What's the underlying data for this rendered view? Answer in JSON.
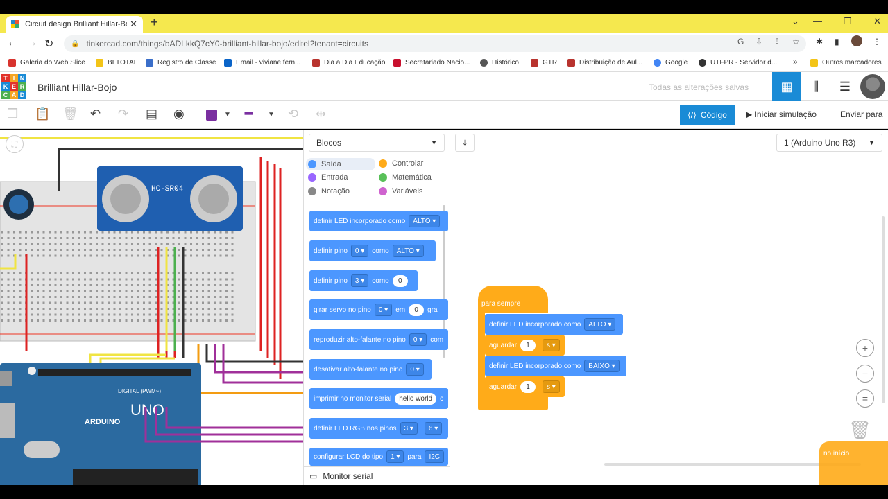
{
  "browser": {
    "tab_title": "Circuit design Brilliant Hillar-Bojo",
    "url": "tinkercad.com/things/bADLkkQ7cY0-brilliant-hillar-bojo/editel?tenant=circuits",
    "bookmarks": [
      "Galeria do Web Slice",
      "BI TOTAL",
      "Registro de Classe",
      "Email - viviane fern...",
      "Dia a Dia Educação",
      "Secretariado Nacio...",
      "Histórico",
      "GTR",
      "Distribuição de Aul...",
      "Google",
      "UTFPR - Servidor d..."
    ],
    "more_bookmarks": "»",
    "other_bookmarks": "Outros marcadores"
  },
  "app": {
    "logo_letters": [
      "T",
      "I",
      "N",
      "K",
      "E",
      "R",
      "C",
      "A",
      "D"
    ],
    "project_title": "Brilliant Hillar-Bojo",
    "save_status": "Todas as alterações salvas"
  },
  "toolbar": {
    "code_label": "Código",
    "simulate_label": "Iniciar simulação",
    "send_label": "Enviar para"
  },
  "code_panel": {
    "mode_select": "Blocos",
    "device_select": "1 (Arduino Uno R3)",
    "categories": [
      {
        "label": "Saída",
        "color": "#4c97ff"
      },
      {
        "label": "Controlar",
        "color": "#ffab19"
      },
      {
        "label": "Entrada",
        "color": "#9966ff"
      },
      {
        "label": "Matemática",
        "color": "#59c059"
      },
      {
        "label": "Notação",
        "color": "#888888"
      },
      {
        "label": "Variáveis",
        "color": "#cf63cf"
      }
    ],
    "palette_blocks": [
      {
        "text": "definir LED incorporado como",
        "arg1": "ALTO ▾"
      },
      {
        "text": "definir pino",
        "arg1": "0 ▾",
        "mid": "como",
        "arg2": "ALTO ▾"
      },
      {
        "text": "definir pino",
        "arg1": "3 ▾",
        "mid": "como",
        "arg2": "0"
      },
      {
        "text": "girar servo no pino",
        "arg1": "0 ▾",
        "mid": "em",
        "arg2": "0",
        "tail": "gra"
      },
      {
        "text": "reproduzir alto-falante no pino",
        "arg1": "0 ▾",
        "tail": "com"
      },
      {
        "text": "desativar alto-falante no pino",
        "arg1": "0 ▾"
      },
      {
        "text": "imprimir no monitor serial",
        "arg1": "hello world",
        "tail": "c"
      },
      {
        "text": "definir LED RGB nos pinos",
        "arg1": "3 ▾",
        "arg2": "6 ▾"
      },
      {
        "text": "configurar LCD do tipo",
        "arg1": "1 ▾",
        "mid": "para",
        "arg2": "I2C"
      }
    ],
    "serial_monitor": "Monitor serial",
    "workspace": {
      "forever_label": "para sempre",
      "stmt1": {
        "text": "definir LED incorporado como",
        "arg": "ALTO ▾"
      },
      "wait1": {
        "text": "aguardar",
        "val": "1",
        "unit": "s ▾"
      },
      "stmt2": {
        "text": "definir LED incorporado como",
        "arg": "BAIXO ▾"
      },
      "wait2": {
        "text": "aguardar",
        "val": "1",
        "unit": "s ▾"
      },
      "dragged_block": "no início"
    }
  },
  "circuit": {
    "sensor_label": "HC-SR04",
    "board_label": "ARDUINO",
    "board_model": "UNO",
    "digital_label": "DIGITAL (PWM~)"
  }
}
